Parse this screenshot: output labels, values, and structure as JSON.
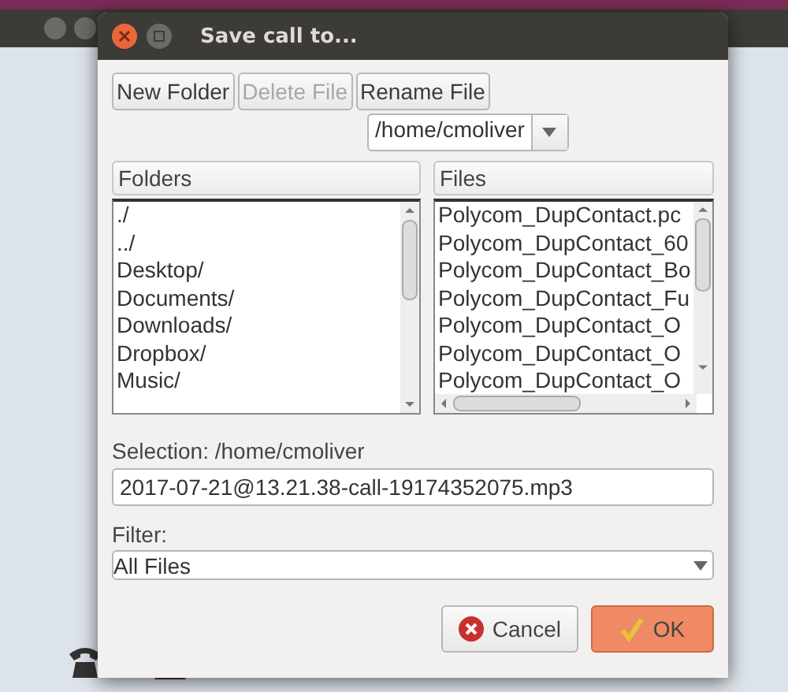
{
  "dialog": {
    "title": "Save call to..."
  },
  "toolbar": [
    {
      "label": "New Folder",
      "disabled": false
    },
    {
      "label": "Delete File",
      "disabled": true
    },
    {
      "label": "Rename File",
      "disabled": false
    }
  ],
  "path_combo": {
    "value": "/home/cmoliver"
  },
  "folders": {
    "header": "Folders",
    "items": [
      "./",
      "../",
      "Desktop/",
      "Documents/",
      "Downloads/",
      "Dropbox/",
      "Music/"
    ]
  },
  "files": {
    "header": "Files",
    "items": [
      "Polycom_DupContact.pc",
      "Polycom_DupContact_60",
      "Polycom_DupContact_Bo",
      "Polycom_DupContact_Fu",
      "Polycom_DupContact_O",
      "Polycom_DupContact_O",
      "Polycom_DupContact_O"
    ]
  },
  "selection_label": "Selection: /home/cmoliver",
  "filename": {
    "value": "2017-07-21@13.21.38-call-19174352075.mp3"
  },
  "filter": {
    "label": "Filter:",
    "value": "All Files"
  },
  "buttons": [
    {
      "label": "Cancel",
      "kind": "cancel"
    },
    {
      "label": "OK",
      "kind": "ok"
    }
  ]
}
